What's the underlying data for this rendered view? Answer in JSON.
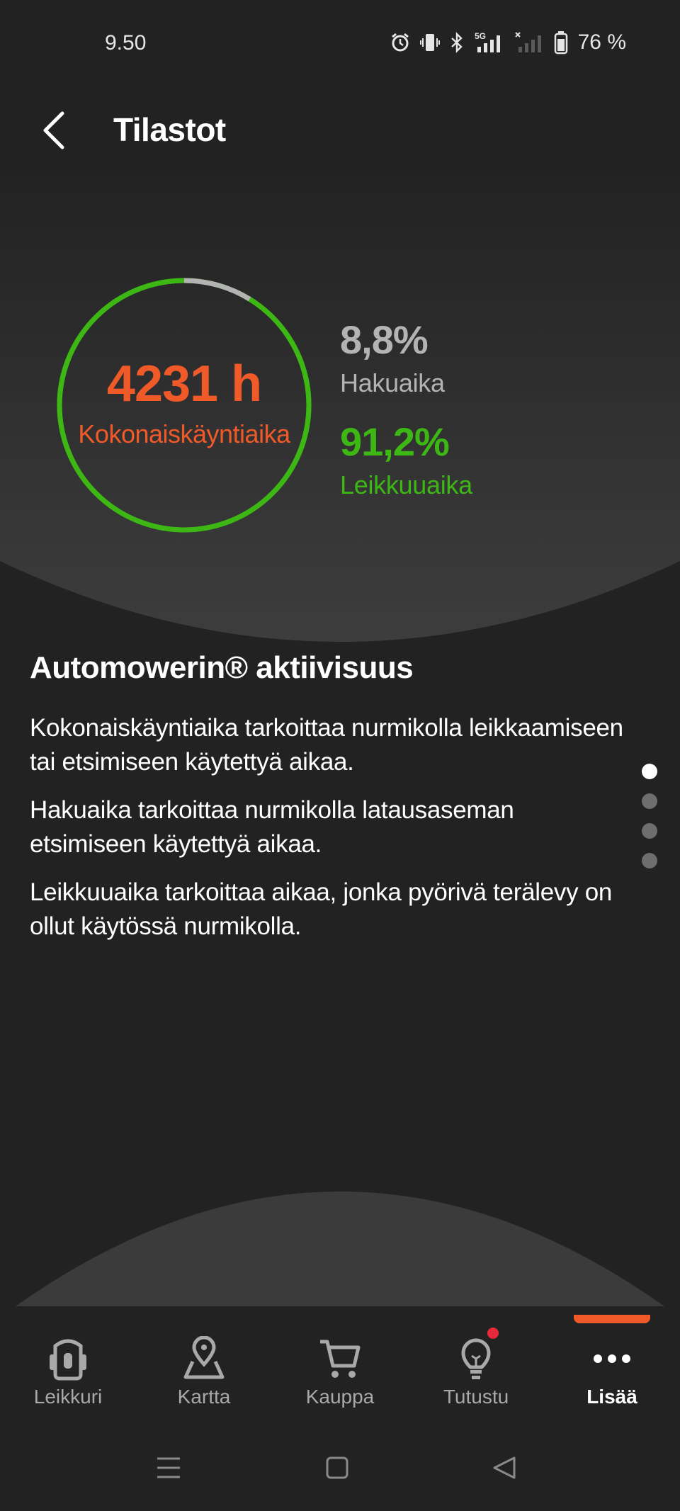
{
  "status_bar": {
    "time": "9.50",
    "battery": "76 %",
    "network_label": "5G",
    "icons": [
      "alarm-icon",
      "vibrate-icon",
      "bluetooth-icon",
      "signal-5g-icon",
      "signal-no-service-icon",
      "battery-icon"
    ]
  },
  "header": {
    "back_icon": "chevron-left-icon",
    "title": "Tilastot"
  },
  "stats": {
    "total_hours": "4231 h",
    "total_label": "Kokonaiskäyntiaika",
    "search_percent": "8,8%",
    "search_label": "Hakuaika",
    "cutting_percent": "91,2%",
    "cutting_label": "Leikkuuaika",
    "search_fraction": 0.088,
    "cutting_fraction": 0.912,
    "colors": {
      "search": "#b3b3b3",
      "cutting": "#3cb714",
      "total": "#f05a28"
    }
  },
  "info": {
    "title": "Automowerin® aktiivisuus",
    "paragraphs": [
      "Kokonaiskäyntiaika tarkoittaa nurmikolla leikkaamiseen tai etsimiseen käytettyä aikaa.",
      "Hakuaika tarkoittaa nurmikolla latausaseman etsimiseen käytettyä aikaa.",
      "Leikkuuaika tarkoittaa aikaa, jonka pyörivä terälevy on ollut käytössä nurmikolla."
    ],
    "page_count": 4,
    "active_page": 1
  },
  "nav": {
    "items": [
      {
        "label": "Leikkuri",
        "icon": "mower-icon"
      },
      {
        "label": "Kartta",
        "icon": "map-pin-icon"
      },
      {
        "label": "Kauppa",
        "icon": "cart-icon"
      },
      {
        "label": "Tutustu",
        "icon": "lightbulb-icon"
      },
      {
        "label": "Lisää",
        "icon": "more-dots-icon"
      }
    ],
    "active_index": 4,
    "accent_color": "#f05a28"
  },
  "system_nav": {
    "icons": [
      "recents-icon",
      "home-icon",
      "back-triangle-icon"
    ]
  }
}
